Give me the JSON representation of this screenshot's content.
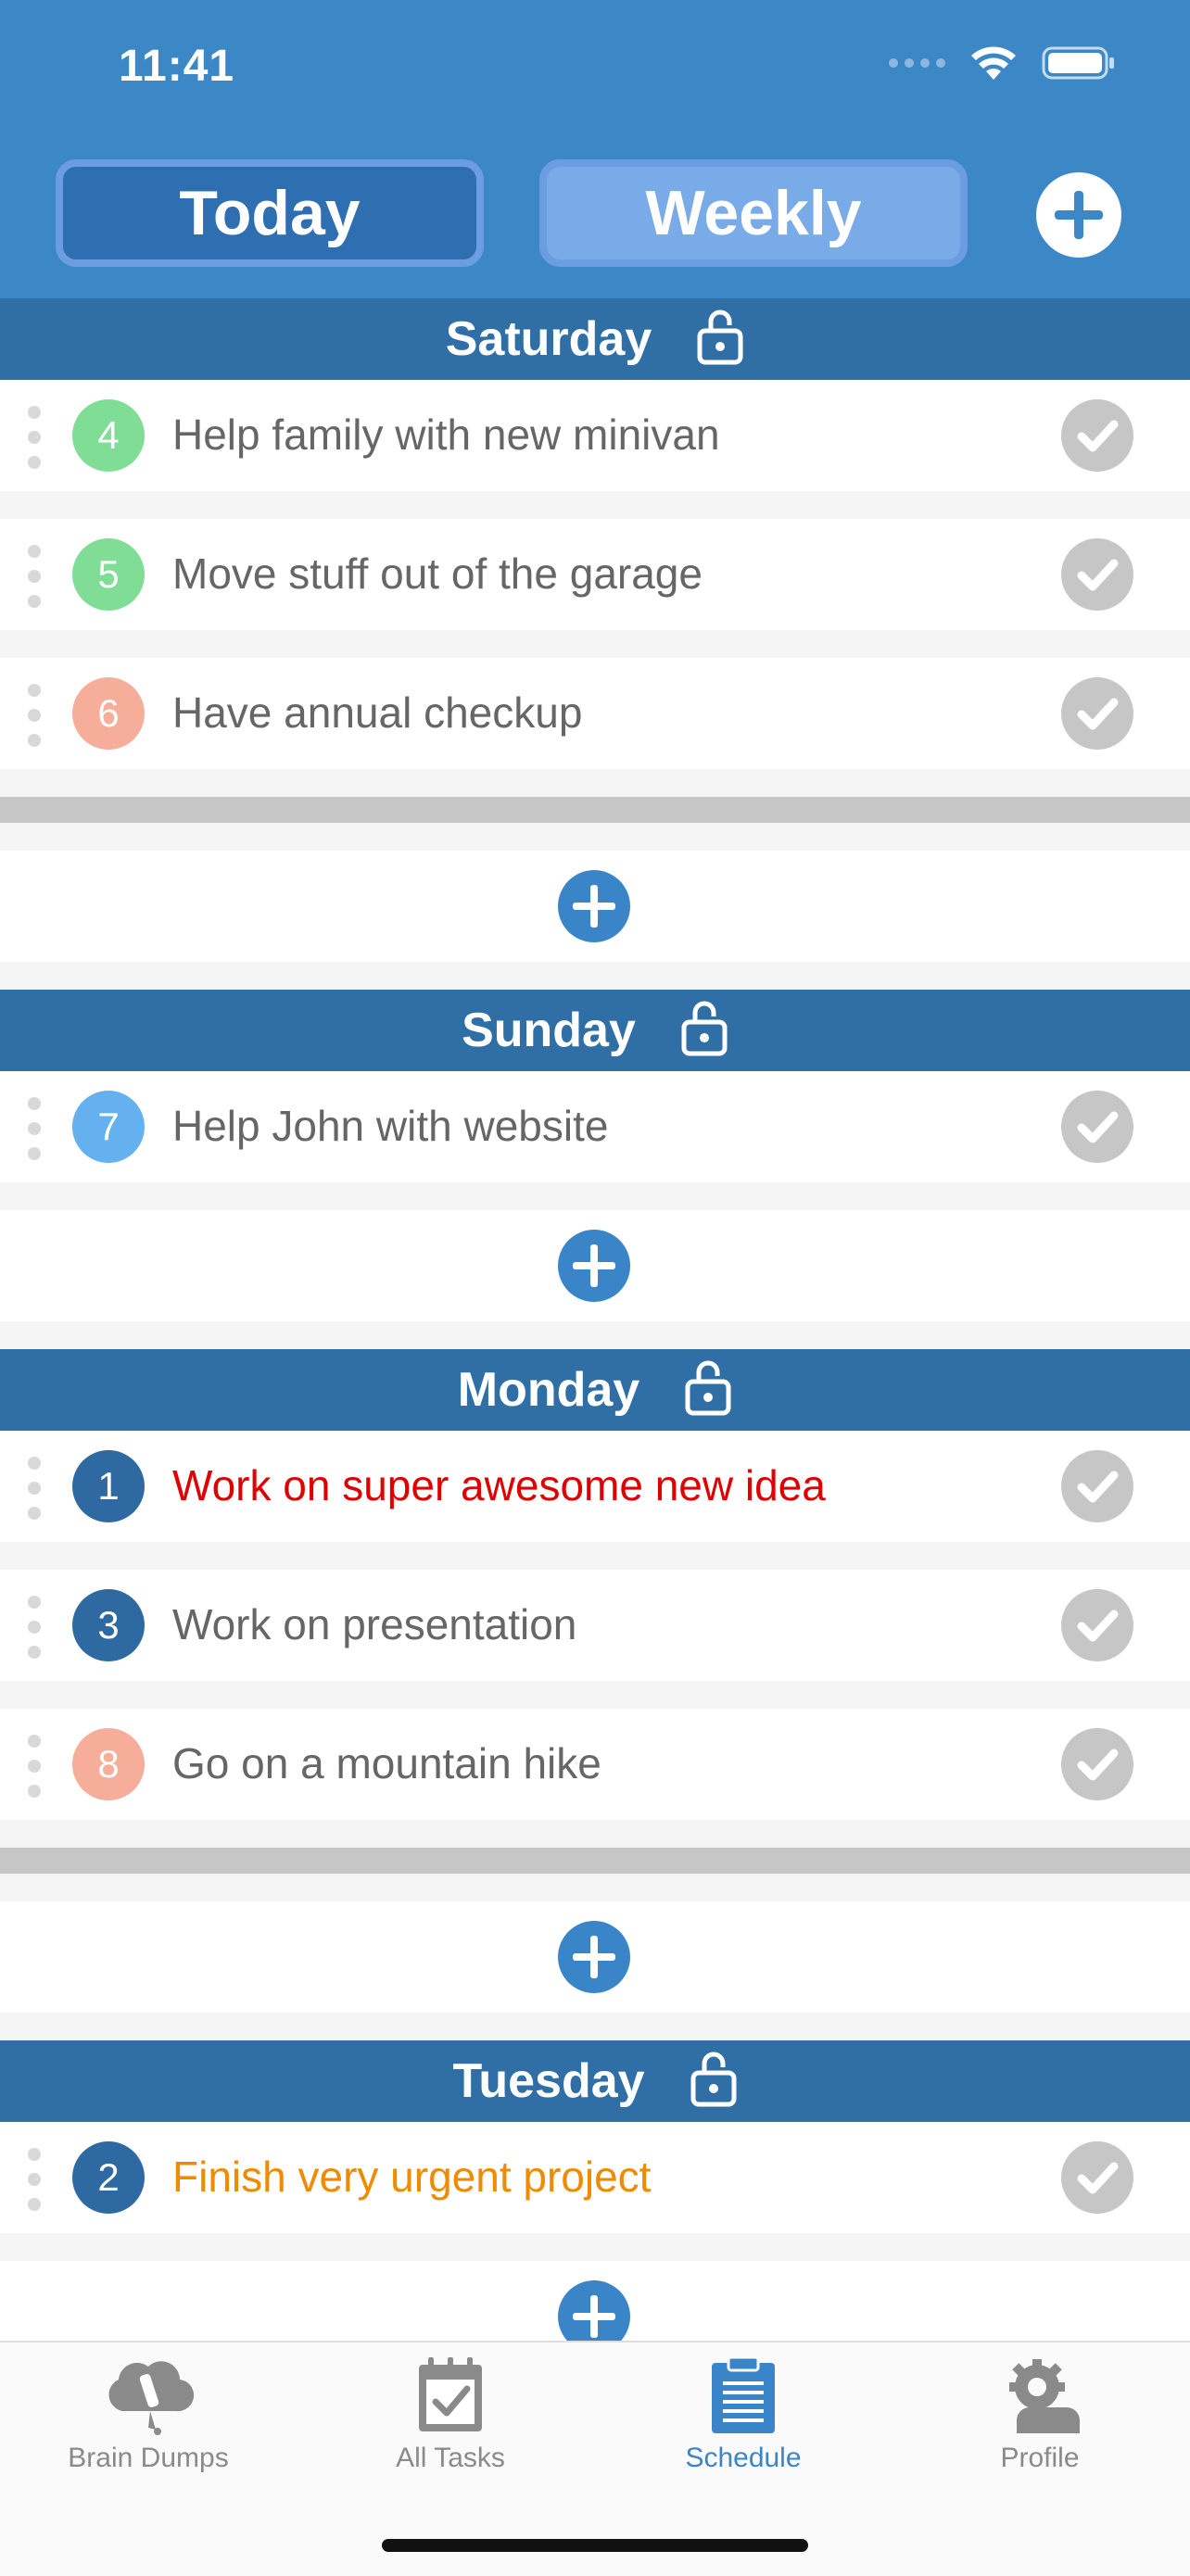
{
  "status": {
    "time": "11:41"
  },
  "header": {
    "tab_today": "Today",
    "tab_weekly": "Weekly",
    "accent": "#3c87c6"
  },
  "days": [
    {
      "name": "Saturday",
      "tasks": [
        {
          "num": "4",
          "text": "Help family with new minivan",
          "badge_color": "#7fdd96",
          "text_color": "#666666"
        },
        {
          "num": "5",
          "text": "Move stuff out of the garage",
          "badge_color": "#7fdd96",
          "text_color": "#666666"
        },
        {
          "num": "6",
          "text": "Have annual checkup",
          "badge_color": "#f6ad99",
          "text_color": "#666666"
        }
      ]
    },
    {
      "name": "Sunday",
      "tasks": [
        {
          "num": "7",
          "text": "Help John with website",
          "badge_color": "#65b1ef",
          "text_color": "#666666"
        }
      ]
    },
    {
      "name": "Monday",
      "tasks": [
        {
          "num": "1",
          "text": "Work on super awesome new idea",
          "badge_color": "#2e6aa1",
          "text_color": "#e00000"
        },
        {
          "num": "3",
          "text": "Work on presentation",
          "badge_color": "#2e6aa1",
          "text_color": "#666666"
        },
        {
          "num": "8",
          "text": "Go on a mountain hike",
          "badge_color": "#f6ad99",
          "text_color": "#666666"
        }
      ]
    },
    {
      "name": "Tuesday",
      "tasks": [
        {
          "num": "2",
          "text": "Finish very urgent project",
          "badge_color": "#2e6aa1",
          "text_color": "#ee8b00"
        }
      ]
    }
  ],
  "tabbar": {
    "brain_dumps": "Brain Dumps",
    "all_tasks": "All Tasks",
    "schedule": "Schedule",
    "profile": "Profile",
    "active": "schedule"
  }
}
